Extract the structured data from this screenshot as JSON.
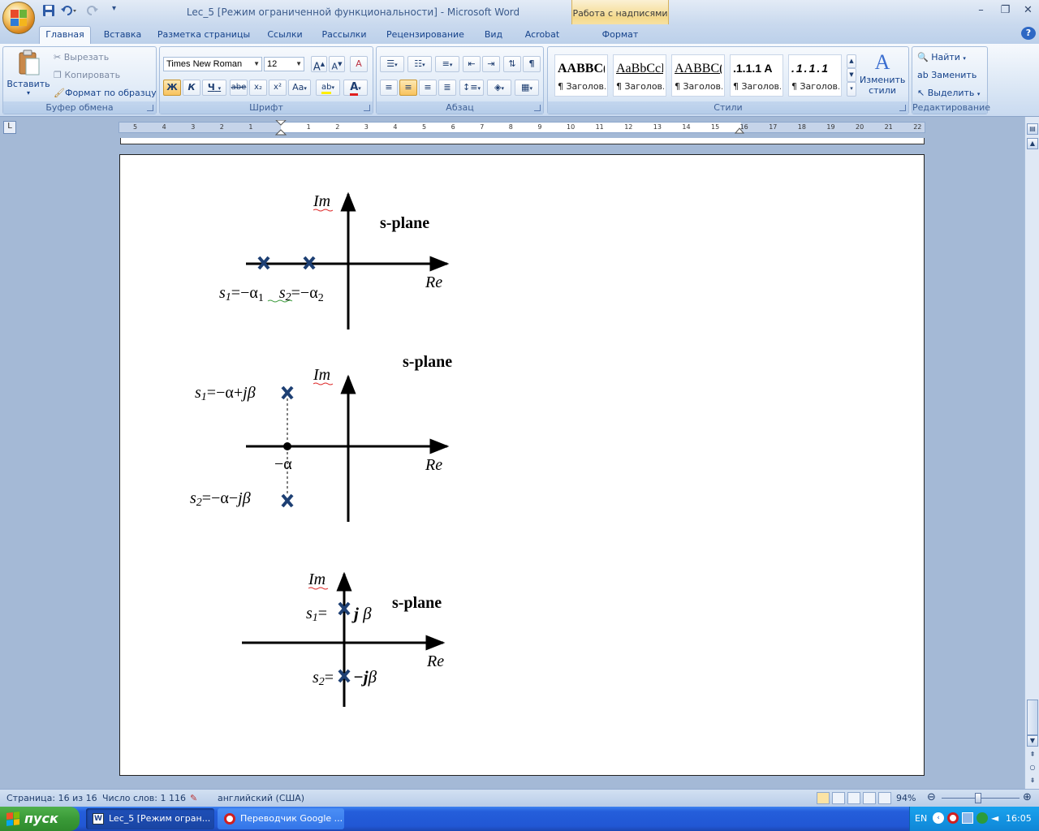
{
  "window": {
    "title": "Lec_5 [Режим ограниченной функциональности] - Microsoft Word",
    "context_group": "Работа с надписями",
    "controls": {
      "minimize": "–",
      "restore": "❐",
      "close": "✕"
    },
    "help_icon": "?"
  },
  "tabs": [
    "Главная",
    "Вставка",
    "Разметка страницы",
    "Ссылки",
    "Рассылки",
    "Рецензирование",
    "Вид",
    "Acrobat",
    "Формат"
  ],
  "ribbon": {
    "clipboard": {
      "paste": "Вставить",
      "cut": "Вырезать",
      "copy": "Копировать",
      "format_painter": "Формат по образцу",
      "label": "Буфер обмена"
    },
    "font": {
      "name": "Times New Roman",
      "size": "12",
      "label": "Шрифт",
      "bold": "Ж",
      "italic": "К",
      "underline": "Ч",
      "strike": "abe",
      "subscript": "x₂",
      "superscript": "x²",
      "case": "Aa",
      "grow": "A",
      "shrink": "A",
      "clear": "A",
      "highlight": "ab",
      "font_color": "A"
    },
    "paragraph": {
      "label": "Абзац",
      "pilcrow": "¶"
    },
    "styles": {
      "label": "Стили",
      "tiles": [
        {
          "sample": "AABBC(",
          "name": "¶ Заголов..."
        },
        {
          "sample": "AaBbCcI",
          "name": "¶ Заголов..."
        },
        {
          "sample": "AABBC(",
          "name": "¶ Заголов..."
        },
        {
          "sample": ".1.1.1  A",
          "name": "¶ Заголов..."
        },
        {
          "sample": ".1.1.1",
          "name": "¶ Заголов..."
        }
      ],
      "change": "Изменить стили"
    },
    "editing": {
      "find": "Найти",
      "replace": "Заменить",
      "select": "Выделить",
      "label": "Редактирование"
    }
  },
  "ruler": {
    "ticks": [
      "5",
      "4",
      "3",
      "2",
      "1",
      "1",
      "2",
      "3",
      "4",
      "5",
      "6",
      "7",
      "8",
      "9",
      "10",
      "11",
      "12",
      "13",
      "14",
      "15",
      "16",
      "17",
      "18",
      "19",
      "20",
      "21",
      "22"
    ]
  },
  "diagrams": [
    {
      "ylabel": "Im",
      "xlabel": "Re",
      "title": "s-plane",
      "labels": [
        "s",
        "1",
        "=−α",
        "1",
        "s",
        "2",
        "=−α",
        "2"
      ]
    },
    {
      "ylabel": "Im",
      "xlabel": "Re",
      "title": "s-plane",
      "labels": [
        "s",
        "1",
        "=−α+",
        "j",
        "β",
        "s",
        "2",
        "=−α−",
        "j",
        "β",
        "−α"
      ]
    },
    {
      "ylabel": "Im",
      "xlabel": "Re",
      "title": "s-plane",
      "labels": [
        "s",
        "1",
        "=",
        "j",
        " β",
        "s",
        "2",
        "=",
        "−j",
        "β"
      ]
    }
  ],
  "status": {
    "page": "Страница: 16 из 16",
    "words": "Число слов: 1 116",
    "language": "английский (США)",
    "zoom": "94%",
    "zoom_level": 0.47
  },
  "taskbar": {
    "start": "пуск",
    "tasks": [
      "Lec_5 [Режим огран...",
      "Переводчик Google ..."
    ],
    "lang": "EN",
    "clock": "16:05"
  }
}
